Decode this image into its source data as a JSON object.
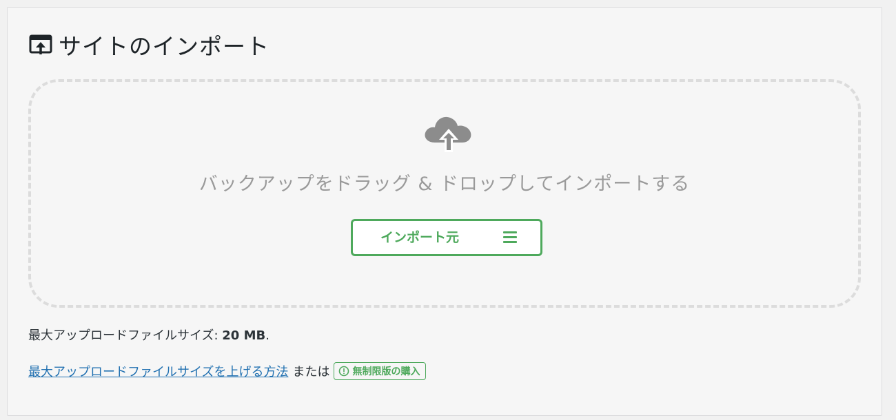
{
  "panel": {
    "title": "サイトのインポート",
    "title_icon": "import-window-icon"
  },
  "dropzone": {
    "icon": "cloud-upload-icon",
    "instruction": "バックアップをドラッグ & ドロップしてインポートする",
    "import_button_label": "インポート元",
    "import_button_icon": "menu-icon"
  },
  "upload_info": {
    "label": "最大アップロードファイルサイズ: ",
    "value": "20 MB",
    "suffix": "."
  },
  "links": {
    "help_link": "最大アップロードファイルサイズを上げる方法",
    "or_text": "または",
    "buy_badge_label": "無制限版の購入",
    "buy_badge_icon": "info-circle-icon"
  },
  "colors": {
    "accent_green": "#4ea95c",
    "link_blue": "#2271b1",
    "muted_text": "#9a9a9a"
  }
}
